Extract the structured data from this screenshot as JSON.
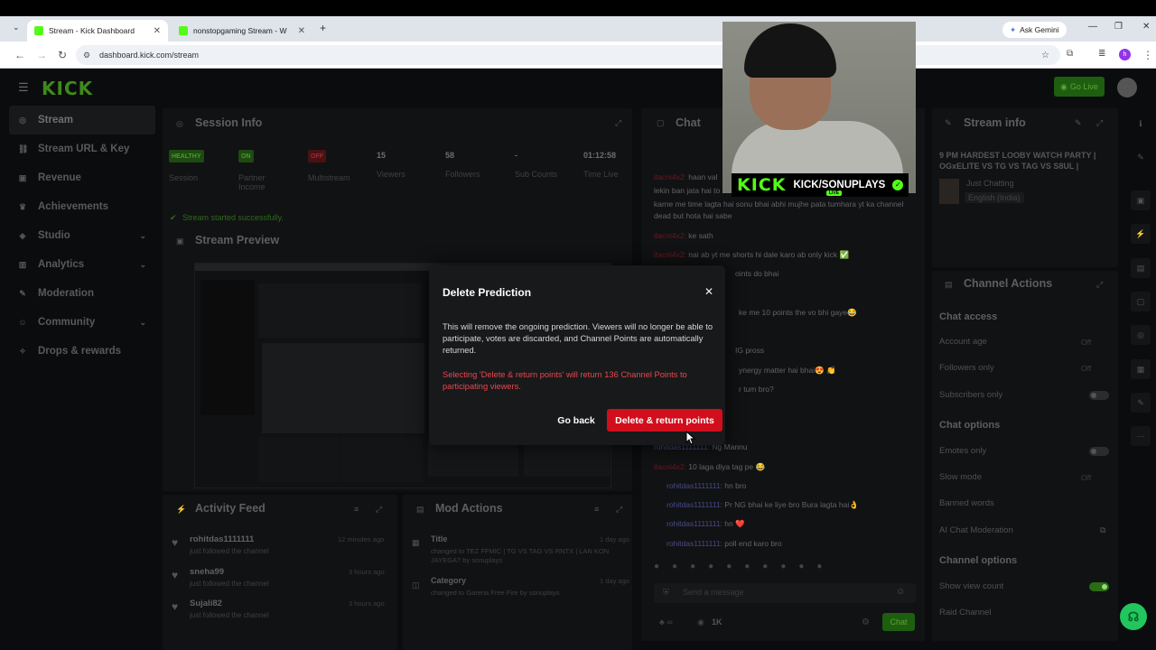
{
  "browser": {
    "tabs": [
      {
        "title": "Stream - Kick Dashboard"
      },
      {
        "title": "nonstopgaming Stream - W"
      }
    ],
    "url": "dashboard.kick.com/stream",
    "gemini": "Ask Gemini"
  },
  "app": {
    "logo": "KICK",
    "go_live": "Go Live",
    "sidebar": [
      {
        "label": "Stream"
      },
      {
        "label": "Stream URL & Key"
      },
      {
        "label": "Revenue"
      },
      {
        "label": "Achievements"
      },
      {
        "label": "Studio"
      },
      {
        "label": "Analytics"
      },
      {
        "label": "Moderation"
      },
      {
        "label": "Community"
      },
      {
        "label": "Drops & rewards"
      }
    ],
    "session_info": {
      "title": "Session Info",
      "badges": [
        "HEALTHY",
        "ON",
        "OFF"
      ],
      "labels": [
        "Session",
        "Partner Income",
        "Multistream",
        "Viewers",
        "Followers",
        "Sub Counts",
        "Time Live"
      ],
      "values": [
        "15",
        "58",
        "-",
        "01:12:58"
      ],
      "status": "Stream started successfully."
    },
    "stream_preview": {
      "title": "Stream Preview"
    },
    "activity_feed": {
      "title": "Activity Feed",
      "items": [
        {
          "user": "rohitdas1111111",
          "action": "just followed the channel",
          "time": "12 minutes ago"
        },
        {
          "user": "sneha99",
          "action": "just followed the channel",
          "time": "3 hours ago"
        },
        {
          "user": "Sujali82",
          "action": "just followed the channel",
          "time": "3 hours ago"
        }
      ]
    },
    "mod_actions": {
      "title": "Mod Actions",
      "items": [
        {
          "label": "Title",
          "detail": "changed to TEZ FFMIC | TG VS TAG VS RNTX | LAN KON JAYEGA? by sonuplays",
          "time": "1 day ago"
        },
        {
          "label": "Category",
          "detail": "changed to Garena Free Fire by sonuplays",
          "time": "1 day ago"
        }
      ]
    },
    "chat": {
      "title": "Chat",
      "lines": [
        {
          "user": "itacni4x2:",
          "text": " haan val"
        },
        {
          "user": "",
          "text": "lekin ban jata hai to"
        },
        {
          "user": "",
          "text": "karne me time lagta hai sonu bhai abhi mujhe pata tumhara yt ka channel dead but hota hai sabe"
        },
        {
          "user": "itacni4x2:",
          "text": " ke sath"
        },
        {
          "user": "itacni4x2:",
          "text": " nai ab yt me shorts hi dale karo ab only kick ✅"
        },
        {
          "user": "",
          "text": "oints do bhai"
        },
        {
          "user": "",
          "text": "ke me 10 points the vo bhi gaye😂"
        },
        {
          "user": "",
          "text": "IG pross"
        },
        {
          "user": "",
          "text": "ynergy matter hai bhai😍 👏"
        },
        {
          "user": "",
          "text": "r tum bro?"
        },
        {
          "user": "rohitdas1111111:",
          "text": " Ng Mannu"
        },
        {
          "user": "itacni4x2:",
          "text": " 10 laga diya tag pe 😂"
        },
        {
          "user": "rohitdas1111111:",
          "text": " hn bro"
        },
        {
          "user": "rohitdas1111111:",
          "text": " Pr NG bhai ke liye bro Bura lagta hai👌"
        },
        {
          "user": "rohitdas1111111:",
          "text": " hn ❤️"
        },
        {
          "user": "rohitdas1111111:",
          "text": " poll end karo bro"
        }
      ],
      "input_placeholder": "Send a message",
      "viewer_count": "1K",
      "send_label": "Chat"
    },
    "stream_info": {
      "title": "Stream info",
      "stream_title": "9 PM HARDEST LOOBY WATCH PARTY | OGxELITE VS TG VS TAG VS S8UL |",
      "category": "Just Chatting",
      "language": "English (India)"
    },
    "channel_actions": {
      "title": "Channel Actions",
      "chat_access_head": "Chat access",
      "chat_access": [
        {
          "label": "Account age",
          "value": "Off"
        },
        {
          "label": "Followers only",
          "value": "Off"
        },
        {
          "label": "Subscribers only",
          "value": ""
        }
      ],
      "chat_options_head": "Chat options",
      "chat_options": [
        {
          "label": "Emotes only",
          "value": ""
        },
        {
          "label": "Slow mode",
          "value": "Off"
        },
        {
          "label": "Banned words",
          "value": ""
        },
        {
          "label": "AI Chat Moderation",
          "value": ""
        }
      ],
      "channel_options_head": "Channel options",
      "channel_options": [
        {
          "label": "Show view count",
          "value": ""
        },
        {
          "label": "Raid Channel",
          "value": ""
        }
      ]
    }
  },
  "overlay": {
    "brand": "KICK",
    "channel": "KICK/SONUPLAYS",
    "live": "LIVE"
  },
  "modal": {
    "title": "Delete Prediction",
    "body": "This will remove the ongoing prediction. Viewers will no longer be able to participate, votes are discarded, and Channel Points are automatically returned.",
    "warning": "Selecting 'Delete & return points' will return 136 Channel Points to participating viewers.",
    "back_label": "Go back",
    "delete_label": "Delete & return points"
  },
  "colors": {
    "accent": "#53fc18",
    "danger": "#d10e1c",
    "warning_text": "#e8474c"
  }
}
